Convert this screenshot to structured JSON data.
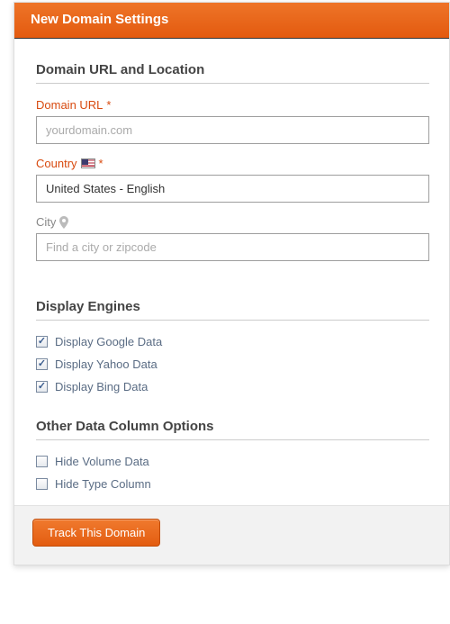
{
  "header": {
    "title": "New Domain Settings"
  },
  "sections": {
    "url_location": {
      "title": "Domain URL and Location",
      "domain_url": {
        "label": "Domain URL",
        "required": "*",
        "placeholder": "yourdomain.com",
        "value": ""
      },
      "country": {
        "label": "Country",
        "required": "*",
        "value": "United States - English"
      },
      "city": {
        "label": "City",
        "placeholder": "Find a city or zipcode",
        "value": ""
      }
    },
    "engines": {
      "title": "Display Engines",
      "items": [
        {
          "label": "Display Google Data",
          "checked": true
        },
        {
          "label": "Display Yahoo Data",
          "checked": true
        },
        {
          "label": "Display Bing Data",
          "checked": true
        }
      ]
    },
    "columns": {
      "title": "Other Data Column Options",
      "items": [
        {
          "label": "Hide Volume Data",
          "checked": false
        },
        {
          "label": "Hide Type Column",
          "checked": false
        }
      ]
    }
  },
  "footer": {
    "submit": "Track This Domain"
  }
}
